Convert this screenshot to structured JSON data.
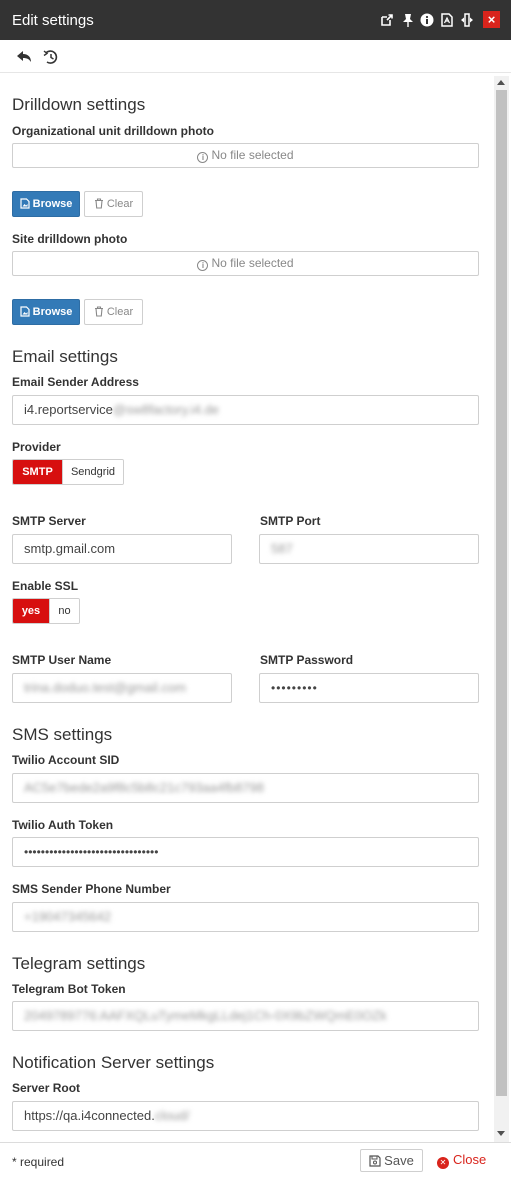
{
  "window": {
    "title": "Edit settings"
  },
  "drilldown": {
    "heading": "Drilldown settings",
    "org_label": "Organizational unit drilldown photo",
    "org_file": "No file selected",
    "site_label": "Site drilldown photo",
    "site_file": "No file selected",
    "browse_label": "Browse",
    "clear_label": "Clear"
  },
  "email": {
    "heading": "Email settings",
    "sender_label": "Email Sender Address",
    "sender_visible": "i4.reportservice",
    "sender_blurred": "@sw8factory.i4.de",
    "provider_label": "Provider",
    "provider_options": [
      "SMTP",
      "Sendgrid"
    ],
    "provider_selected": "SMTP",
    "smtp_server_label": "SMTP Server",
    "smtp_server_value": "smtp.gmail.com",
    "smtp_port_label": "SMTP Port",
    "smtp_port_value": "587",
    "ssl_label": "Enable SSL",
    "ssl_options": [
      "yes",
      "no"
    ],
    "ssl_selected": "yes",
    "user_label": "SMTP User Name",
    "user_value": "trina.doduo.test@gmail.com",
    "password_label": "SMTP Password",
    "password_value": "•••••••••"
  },
  "sms": {
    "heading": "SMS settings",
    "sid_label": "Twilio Account SID",
    "sid_value": "AC5e7bede2a9f8c5b8c21c793aa4fb8798",
    "token_label": "Twilio Auth Token",
    "token_value": "••••••••••••••••••••••••••••••••",
    "phone_label": "SMS Sender Phone Number",
    "phone_value": "+19047345642"
  },
  "telegram": {
    "heading": "Telegram settings",
    "token_label": "Telegram Bot Token",
    "token_value": "2049789776:AAFXQLuTymeMkgLLdej1Ch-0X9bZWQmE0OZk"
  },
  "notification": {
    "heading": "Notification Server settings",
    "root_label": "Server Root",
    "root_visible": "https://qa.i4connected.",
    "root_blurred": "cloud/"
  },
  "footer": {
    "required_note": "* required",
    "save_label": "Save",
    "close_label": "Close"
  },
  "colors": {
    "accent_red": "#d70f0f",
    "primary_blue": "#337ab7",
    "titlebar": "#333333"
  },
  "icons": {
    "titlebar": [
      "external-link-icon",
      "pin-icon",
      "info-icon",
      "pdf-icon",
      "resize-icon",
      "close-icon"
    ],
    "toolbar": [
      "undo-icon",
      "history-icon"
    ]
  }
}
